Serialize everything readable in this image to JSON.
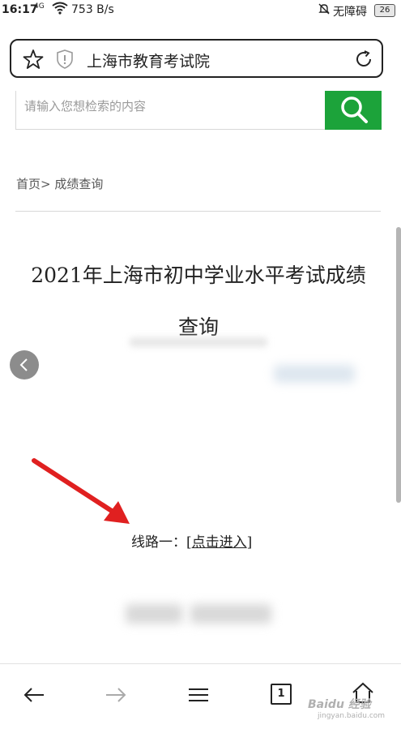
{
  "status_bar": {
    "time": "16:17",
    "signal": "4G",
    "net_speed": "753 B/s",
    "do_not_disturb": "无障碍",
    "battery": "26"
  },
  "address_bar": {
    "title": "上海市教育考试院"
  },
  "search": {
    "placeholder": "请输入您想检索的内容"
  },
  "breadcrumb": "首页> 成绩查询",
  "page": {
    "title_line1": "2021年上海市初中学业水平考试成绩",
    "title_line2": "查询",
    "line_one_label": "线路一：",
    "line_one_open": "[",
    "line_one_link": "点击进入",
    "line_one_close": "]"
  },
  "bottom_nav": {
    "tab_count": "1"
  },
  "watermark": {
    "text": "Baidu 经验",
    "sub": "jingyan.baidu.com"
  },
  "colors": {
    "search_button": "#1ca33a",
    "annotation_arrow": "#e02020"
  }
}
